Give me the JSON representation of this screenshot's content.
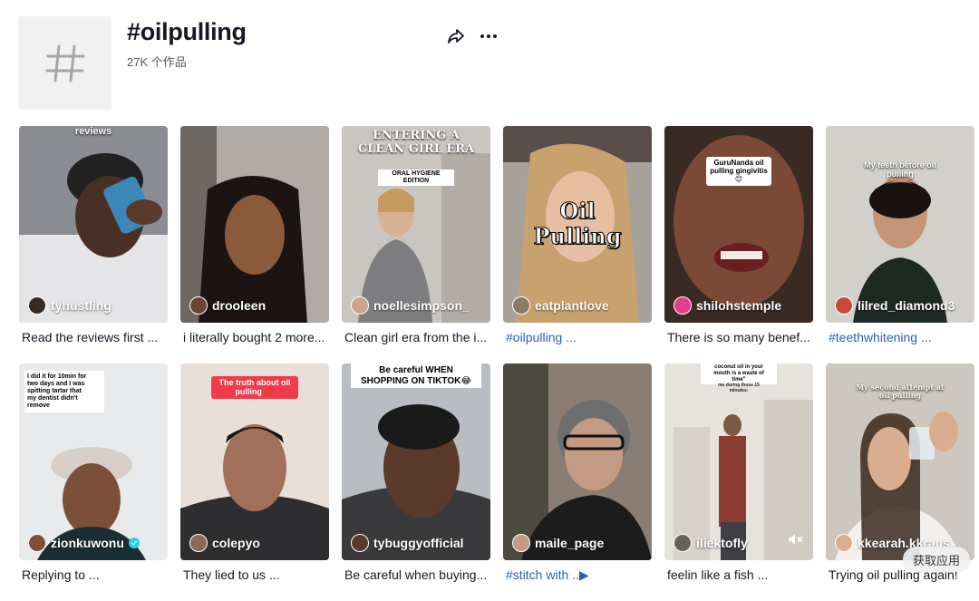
{
  "header": {
    "title": "#oilpulling",
    "count": "27K 个作品",
    "hash_icon": "hashtag-icon",
    "share_icon": "share-icon",
    "more_icon": "more-icon"
  },
  "videos": [
    {
      "author": "tyhustling",
      "caption": "Read the reviews first ...",
      "overlay": "reviews"
    },
    {
      "author": "drooleen",
      "caption": "i literally bought 2 more...",
      "overlay": ""
    },
    {
      "author": "noellesimpson_",
      "caption": "Clean girl era from the i...",
      "overlay": "ENTERING A\nCLEAN GIRL ERA",
      "overlay2": "ORAL HYGIENE EDITION"
    },
    {
      "author": "eatplantlove",
      "caption": "#oilpulling ...",
      "overlay": "Oil\nPulling"
    },
    {
      "author": "shilohstemple",
      "caption": "There is so many benef...",
      "overlay": "GuruNanda oil\npulling gingivitis 😊"
    },
    {
      "author": "lilred_diamond3",
      "caption": "#teethwhitening ...",
      "overlay": "My teeth before oil\npulling"
    },
    {
      "author": "zionkuwonu",
      "caption": "Replying to ...",
      "overlay": "I did it for 10min for\ntwo days and I was\nspitting tartar that\nmy dentist didn't\nremove",
      "verified": true
    },
    {
      "author": "colepyo",
      "caption": "They lied to us ...",
      "overlay": "The truth about oil\npulling 💋"
    },
    {
      "author": "tybuggyofficial",
      "caption": "Be careful when buying...",
      "overlay": "Be careful WHEN\nSHOPPING ON TIKTOK😂"
    },
    {
      "author": "maile_page",
      "caption": "#stitch with ..▶",
      "overlay": ""
    },
    {
      "author": "iliektofly",
      "caption": "feelin like a fish ...",
      "overlay": "coconut oil in your\nmouth is a waste of\ntime\"",
      "overlay2": "me during those 15\nminutes:"
    },
    {
      "author": "kkearah.kkraus",
      "caption": "Trying oil pulling again!",
      "overlay": "My second attempt at\noil pulling"
    }
  ],
  "get_app": "获取应用",
  "colors": {
    "text": "#161823",
    "hashtag_link": "#2b5db9",
    "verified": "#20d5ec"
  }
}
